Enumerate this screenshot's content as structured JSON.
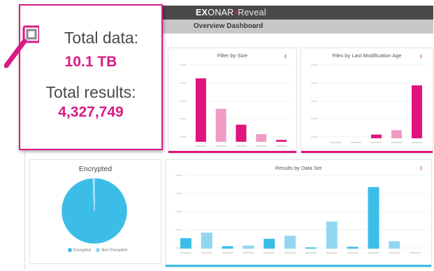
{
  "app": {
    "brand_ex": "EX",
    "brand_o": "O",
    "brand_nar": "NAR",
    "brand_chevron": ">",
    "brand_reveal": "Reveal",
    "page_title": "Overview Dashboard"
  },
  "colors": {
    "accent": "#e0147e",
    "accent_light": "#ee9cc6",
    "blue": "#3cbde8",
    "blue_light": "#92d6ef",
    "topbar": "#4a4a4a",
    "subbar": "#c8c8c8"
  },
  "callout": {
    "total_data_label": "Total data:",
    "total_data_value": "10.1 TB",
    "total_results_label": "Total results:",
    "total_results_value": "4,327,749",
    "icon": "magnifier-icon"
  },
  "panels": {
    "filter_by_size": {
      "title": "Filter by Size",
      "download_icon": "download-icon"
    },
    "files_by_age": {
      "title": "Files by Last Modification Age",
      "download_icon": "download-icon"
    },
    "encrypted": {
      "title": "Encrypted",
      "legend": [
        "Encrypted",
        "Non Encrypted"
      ]
    },
    "results_by_data_set": {
      "title": "Results by Data Set",
      "download_icon": "download-icon"
    }
  },
  "chart_data": [
    {
      "type": "bar",
      "title": "Filter by Size",
      "categories": [
        "",
        "",
        "",
        "",
        ""
      ],
      "values": [
        100,
        52,
        27,
        12,
        3
      ],
      "colors": [
        "#e0147e",
        "#ee9cc6",
        "#e0147e",
        "#ee9cc6",
        "#e0147e"
      ],
      "ylim": [
        0,
        120
      ]
    },
    {
      "type": "bar",
      "title": "Files by Last Modification Age",
      "categories": [
        "",
        "",
        "",
        "",
        ""
      ],
      "values": [
        0,
        0,
        6,
        13,
        85
      ],
      "colors": [
        "#e0147e",
        "#ee9cc6",
        "#e0147e",
        "#ee9cc6",
        "#e0147e"
      ],
      "ylim": [
        0,
        120
      ]
    },
    {
      "type": "pie",
      "title": "Encrypted",
      "labels": [
        "Encrypted",
        "Non Encrypted"
      ],
      "values": [
        99.3,
        0.7
      ],
      "colors": [
        "#3cbde8",
        "#92d6ef"
      ]
    },
    {
      "type": "bar",
      "title": "Results by Data Set",
      "categories": [
        "",
        "",
        "",
        "",
        "",
        "",
        "",
        "",
        "",
        "",
        "",
        ""
      ],
      "values": [
        17,
        26,
        4,
        5,
        16,
        21,
        2,
        44,
        3,
        100,
        12,
        0
      ],
      "colors": [
        "#3cbde8",
        "#92d6ef",
        "#3cbde8",
        "#92d6ef",
        "#3cbde8",
        "#92d6ef",
        "#3cbde8",
        "#92d6ef",
        "#3cbde8",
        "#3cbde8",
        "#92d6ef",
        "#3cbde8"
      ],
      "ylim": [
        0,
        110
      ]
    }
  ]
}
